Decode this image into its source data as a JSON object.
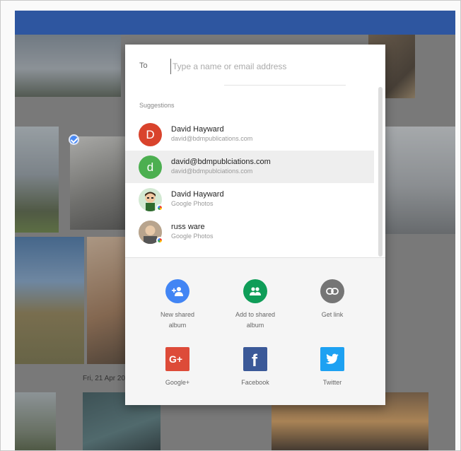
{
  "share_dialog": {
    "to_label": "To",
    "to_placeholder": "Type a name or email address",
    "suggestions_title": "Suggestions",
    "suggestions": [
      {
        "avatar": "D",
        "name": "David Hayward",
        "sub": "david@bdmpublications.com",
        "selected": false
      },
      {
        "avatar": "d",
        "name": "david@bdmpublciations.com",
        "sub": "david@bdmpublciations.com",
        "selected": true
      },
      {
        "avatar": "cartoon-avatar",
        "name": "David Hayward",
        "sub": "Google Photos",
        "selected": false
      },
      {
        "avatar": "photo-avatar",
        "name": "russ ware",
        "sub": "Google Photos",
        "selected": false
      }
    ],
    "share_options": [
      {
        "label_line1": "New shared",
        "label_line2": "album",
        "icon": "new-shared-album-icon",
        "color": "#4285f4"
      },
      {
        "label_line1": "Add to shared",
        "label_line2": "album",
        "icon": "add-to-shared-album-icon",
        "color": "#0f9d58"
      },
      {
        "label_line1": "Get link",
        "label_line2": "",
        "icon": "link-icon",
        "color": "#757575"
      },
      {
        "label_line1": "Google+",
        "label_line2": "",
        "icon": "google-plus-icon",
        "color": "#dd4b39"
      },
      {
        "label_line1": "Facebook",
        "label_line2": "",
        "icon": "facebook-icon",
        "color": "#3b5998"
      },
      {
        "label_line1": "Twitter",
        "label_line2": "",
        "icon": "twitter-icon",
        "color": "#1da1f2"
      }
    ]
  },
  "background": {
    "date_label": "Fri, 21 Apr 20",
    "header_color": "#2e56a0"
  }
}
